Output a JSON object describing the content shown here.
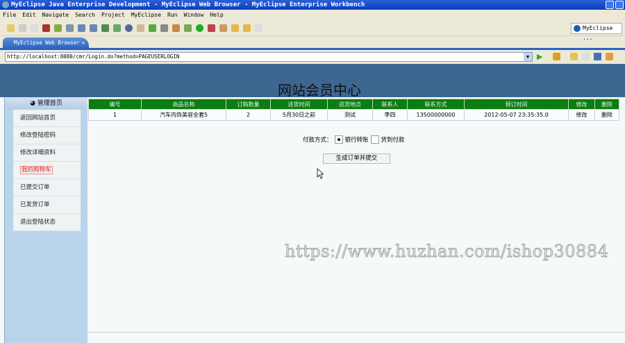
{
  "window": {
    "title": "MyEclipse Java Enterprise Development - MyEclipse Web Browser - MyEclipse Enterprise Workbench"
  },
  "menu": [
    "File",
    "Edit",
    "Navigate",
    "Search",
    "Project",
    "MyEclipse",
    "Run",
    "Window",
    "Help"
  ],
  "perspective": "MyEclipse ...",
  "tab": {
    "label": "MyEclipse Web Browser",
    "close": "✕"
  },
  "url": "http://localhost:8080/cmr/Login.do?method=PAGEUSERLOGIN",
  "page": {
    "title": "网站会员中心",
    "sidebar": {
      "heading": "管理首页",
      "items": [
        "返回网站首页",
        "修改登陆密码",
        "修改详细资料",
        "我的购物车",
        "已提交订单",
        "已发货订单",
        "退出登陆状态"
      ]
    },
    "table": {
      "headers": [
        "编号",
        "商品名称",
        "订购数量",
        "送货时间",
        "送货地点",
        "联系人",
        "联系方式",
        "预订时间",
        "修改",
        "删除"
      ],
      "rows": [
        [
          "1",
          "汽车内饰美容全套5",
          "2",
          "5月30日之前",
          "测试",
          "李四",
          "13500000000",
          "2012-05-07 23:35:35.0",
          "修改",
          "删除"
        ]
      ]
    },
    "payment": {
      "label": "付款方式：",
      "options": [
        "银行转账",
        "货到付款"
      ],
      "selected": 0
    },
    "submit": "生成订单并提交",
    "watermark": "https://www.huzhan.com/ishop30884"
  }
}
